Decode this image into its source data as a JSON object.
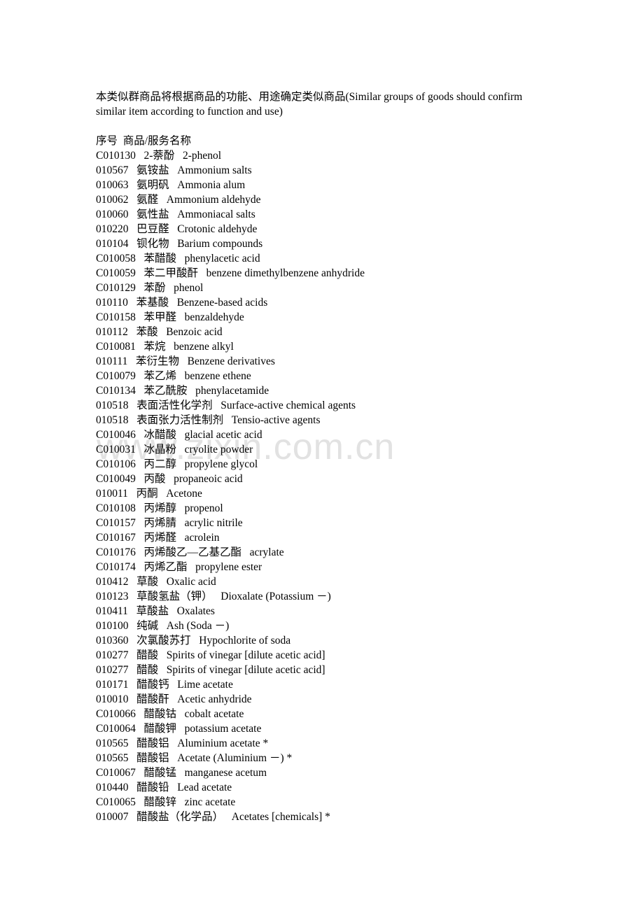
{
  "document": {
    "intro_paragraph": "本类似群商品将根据商品的功能、用途确定类似商品(Similar groups of goods should confirm similar item according to function and use)",
    "watermark_text": "www.zixin.com.cn",
    "list_header": "序号  商品/服务名称",
    "columns": {
      "code_label": "序号",
      "name_label": "商品/服务名称"
    },
    "colors": {
      "text": "#000000",
      "background": "#ffffff",
      "watermark": "#e2e2e2"
    }
  },
  "entries": [
    {
      "code": "C010130",
      "cn": "2-萘酚",
      "en": "2-phenol"
    },
    {
      "code": "010567",
      "cn": "氨铵盐",
      "en": "Ammonium salts"
    },
    {
      "code": "010063",
      "cn": "氨明矾",
      "en": "Ammonia alum"
    },
    {
      "code": "010062",
      "cn": "氨醛",
      "en": "Ammonium aldehyde"
    },
    {
      "code": "010060",
      "cn": "氨性盐",
      "en": "Ammoniacal salts"
    },
    {
      "code": "010220",
      "cn": "巴豆醛",
      "en": "Crotonic aldehyde"
    },
    {
      "code": "010104",
      "cn": "钡化物",
      "en": "Barium compounds"
    },
    {
      "code": "C010058",
      "cn": "苯醋酸",
      "en": "phenylacetic acid"
    },
    {
      "code": "C010059",
      "cn": "苯二甲酸酐",
      "en": "benzene dimethylbenzene anhydride"
    },
    {
      "code": "C010129",
      "cn": "苯酚",
      "en": "phenol"
    },
    {
      "code": "010110",
      "cn": "苯基酸",
      "en": "Benzene-based acids"
    },
    {
      "code": "C010158",
      "cn": "苯甲醛",
      "en": "benzaldehyde"
    },
    {
      "code": "010112",
      "cn": "苯酸",
      "en": "Benzoic acid"
    },
    {
      "code": "C010081",
      "cn": "苯烷",
      "en": "benzene alkyl"
    },
    {
      "code": "010111",
      "cn": "苯衍生物",
      "en": "Benzene derivatives"
    },
    {
      "code": "C010079",
      "cn": "苯乙烯",
      "en": "benzene ethene"
    },
    {
      "code": "C010134",
      "cn": "苯乙酰胺",
      "en": "phenylacetamide"
    },
    {
      "code": "010518",
      "cn": "表面活性化学剂",
      "en": "Surface-active chemical agents"
    },
    {
      "code": "010518",
      "cn": "表面张力活性制剂",
      "en": "Tensio-active agents"
    },
    {
      "code": "C010046",
      "cn": "冰醋酸",
      "en": "glacial acetic acid"
    },
    {
      "code": "C010031",
      "cn": "冰晶粉",
      "en": "cryolite powder"
    },
    {
      "code": "C010106",
      "cn": "丙二醇",
      "en": "propylene glycol"
    },
    {
      "code": "C010049",
      "cn": "丙酸",
      "en": "propaneoic acid"
    },
    {
      "code": "010011",
      "cn": "丙酮",
      "en": "Acetone"
    },
    {
      "code": "C010108",
      "cn": "丙烯醇",
      "en": "propenol"
    },
    {
      "code": "C010157",
      "cn": "丙烯腈",
      "en": "acrylic nitrile"
    },
    {
      "code": "C010167",
      "cn": "丙烯醛",
      "en": "acrolein"
    },
    {
      "code": "C010176",
      "cn": "丙烯酸乙—乙基乙酯",
      "en": "acrylate"
    },
    {
      "code": "C010174",
      "cn": "丙烯乙酯",
      "en": "propylene ester"
    },
    {
      "code": "010412",
      "cn": "草酸",
      "en": "Oxalic acid"
    },
    {
      "code": "010123",
      "cn": "草酸氢盐（钾）",
      "en": "Dioxalate (Potassium －)"
    },
    {
      "code": "010411",
      "cn": "草酸盐",
      "en": "Oxalates"
    },
    {
      "code": "010100",
      "cn": "纯碱",
      "en": "Ash (Soda －)"
    },
    {
      "code": "010360",
      "cn": "次氯酸苏打",
      "en": "Hypochlorite of soda"
    },
    {
      "code": "010277",
      "cn": "醋酸",
      "en": "Spirits of vinegar [dilute acetic acid]"
    },
    {
      "code": "010277",
      "cn": "醋酸",
      "en": "Spirits of vinegar [dilute acetic acid]"
    },
    {
      "code": "010171",
      "cn": "醋酸钙",
      "en": "Lime acetate"
    },
    {
      "code": "010010",
      "cn": "醋酸酐",
      "en": "Acetic anhydride"
    },
    {
      "code": "C010066",
      "cn": "醋酸钴",
      "en": "cobalt acetate"
    },
    {
      "code": "C010064",
      "cn": "醋酸钾",
      "en": "potassium acetate"
    },
    {
      "code": "010565",
      "cn": "醋酸铝",
      "en": "Aluminium acetate *"
    },
    {
      "code": "010565",
      "cn": "醋酸铝",
      "en": "Acetate (Aluminium －) *"
    },
    {
      "code": "C010067",
      "cn": "醋酸锰",
      "en": "manganese acetum"
    },
    {
      "code": "010440",
      "cn": "醋酸铅",
      "en": "Lead acetate"
    },
    {
      "code": "C010065",
      "cn": "醋酸锌",
      "en": "zinc acetate"
    },
    {
      "code": "010007",
      "cn": "醋酸盐（化学品）",
      "en": "Acetates [chemicals] *"
    }
  ]
}
